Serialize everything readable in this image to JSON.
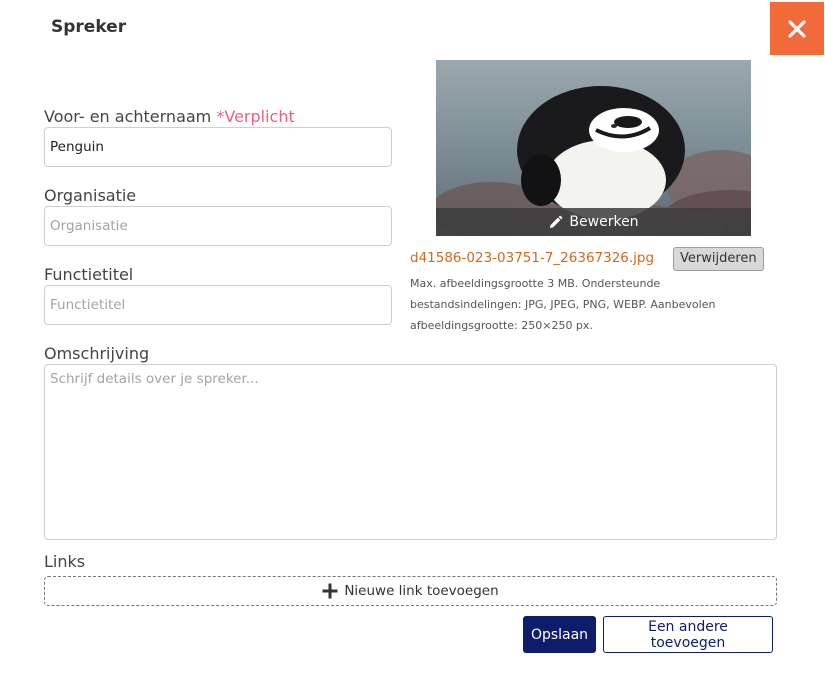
{
  "dialog": {
    "title": "Spreker",
    "accent_color": "#f26a3a",
    "close_icon": "close-icon"
  },
  "fields": {
    "name": {
      "label": "Voor- en achternaam",
      "required_label": "*Verplicht",
      "value": "Penguin",
      "placeholder": ""
    },
    "organization": {
      "label": "Organisatie",
      "value": "",
      "placeholder": "Organisatie"
    },
    "job_title": {
      "label": "Functietitel",
      "value": "",
      "placeholder": "Functietitel"
    },
    "description": {
      "label": "Omschrijving",
      "value": "",
      "placeholder": "Schrijf details over je spreker..."
    }
  },
  "image": {
    "edit_label": "Bewerken",
    "edit_icon": "pencil-icon",
    "filename": "d41586-023-03751-7_26367326.jpg",
    "remove_label": "Verwijderen",
    "help_text": "Max. afbeeldingsgrootte 3 MB. Ondersteunde bestandsindelingen: JPG, JPEG, PNG, WEBP. Aanbevolen afbeeldingsgrootte: 250×250 px."
  },
  "links": {
    "label": "Links",
    "add_label": "Nieuwe link toevoegen",
    "add_icon": "plus-icon"
  },
  "actions": {
    "save_label": "Opslaan",
    "add_another_label": "Een andere toevoegen",
    "primary_color": "#0e1d6b"
  }
}
